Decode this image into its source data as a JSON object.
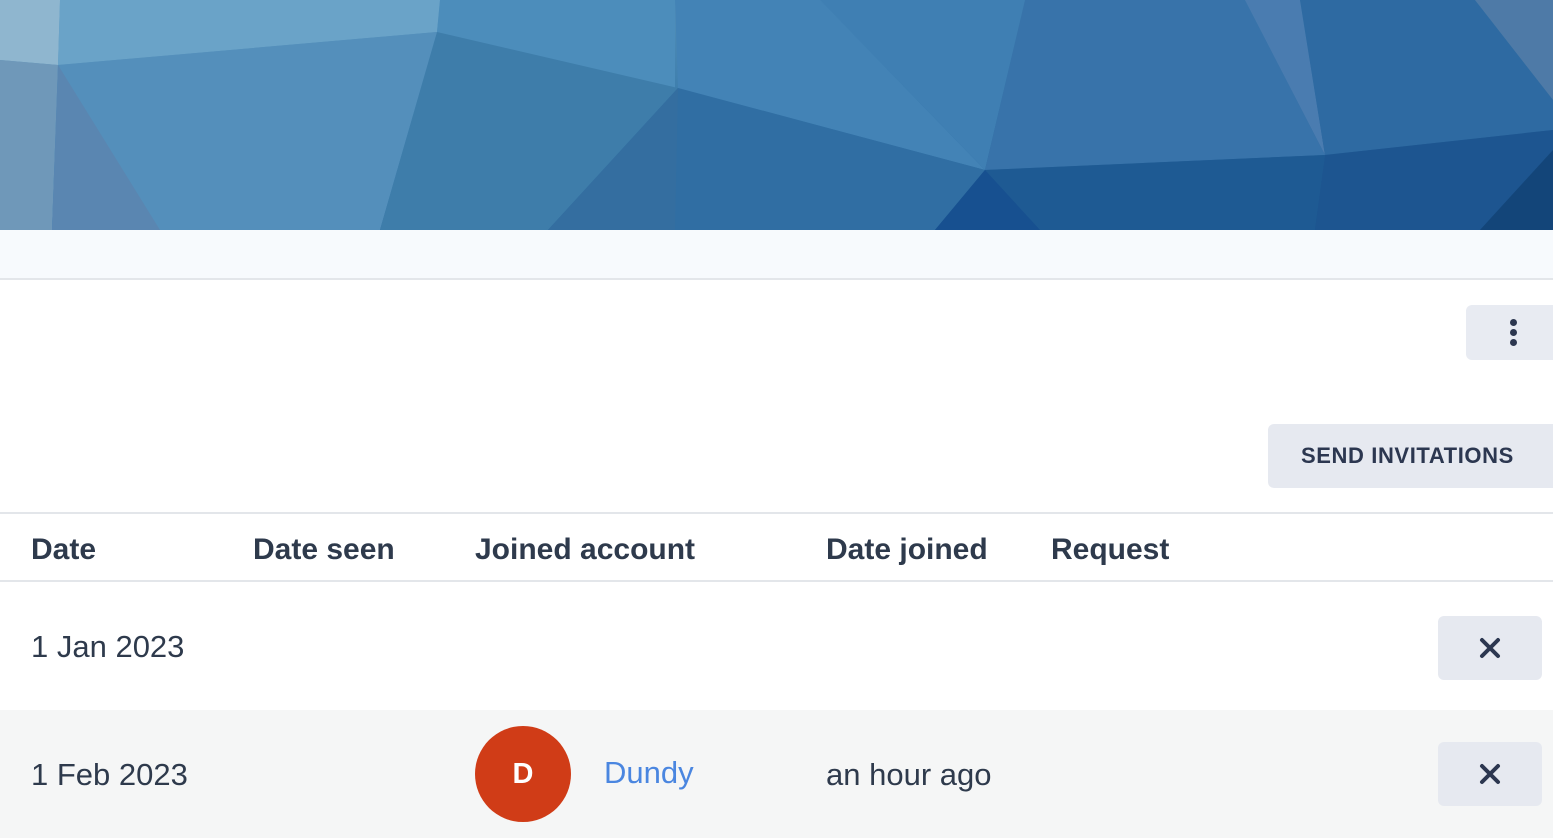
{
  "colors": {
    "accent_link": "#4a86e0",
    "avatar_bg": "#d03c17",
    "button_bg": "#e6e9f0",
    "text": "#2e3a4c"
  },
  "header": {
    "more_icon": "more-vertical-icon"
  },
  "toolbar": {
    "send_invitations_label": "SEND INVITATIONS"
  },
  "table": {
    "columns": [
      "Date",
      "Date seen",
      "Joined account",
      "Date joined",
      "Request"
    ],
    "rows": [
      {
        "date": "1 Jan 2023",
        "date_seen": "",
        "account_initial": "",
        "account_name": "",
        "date_joined": "",
        "request": "",
        "action_icon": "close-icon"
      },
      {
        "date": "1 Feb 2023",
        "date_seen": "",
        "account_initial": "D",
        "account_name": "Dundy",
        "date_joined": "an hour ago",
        "request": "",
        "action_icon": "close-icon"
      }
    ]
  }
}
